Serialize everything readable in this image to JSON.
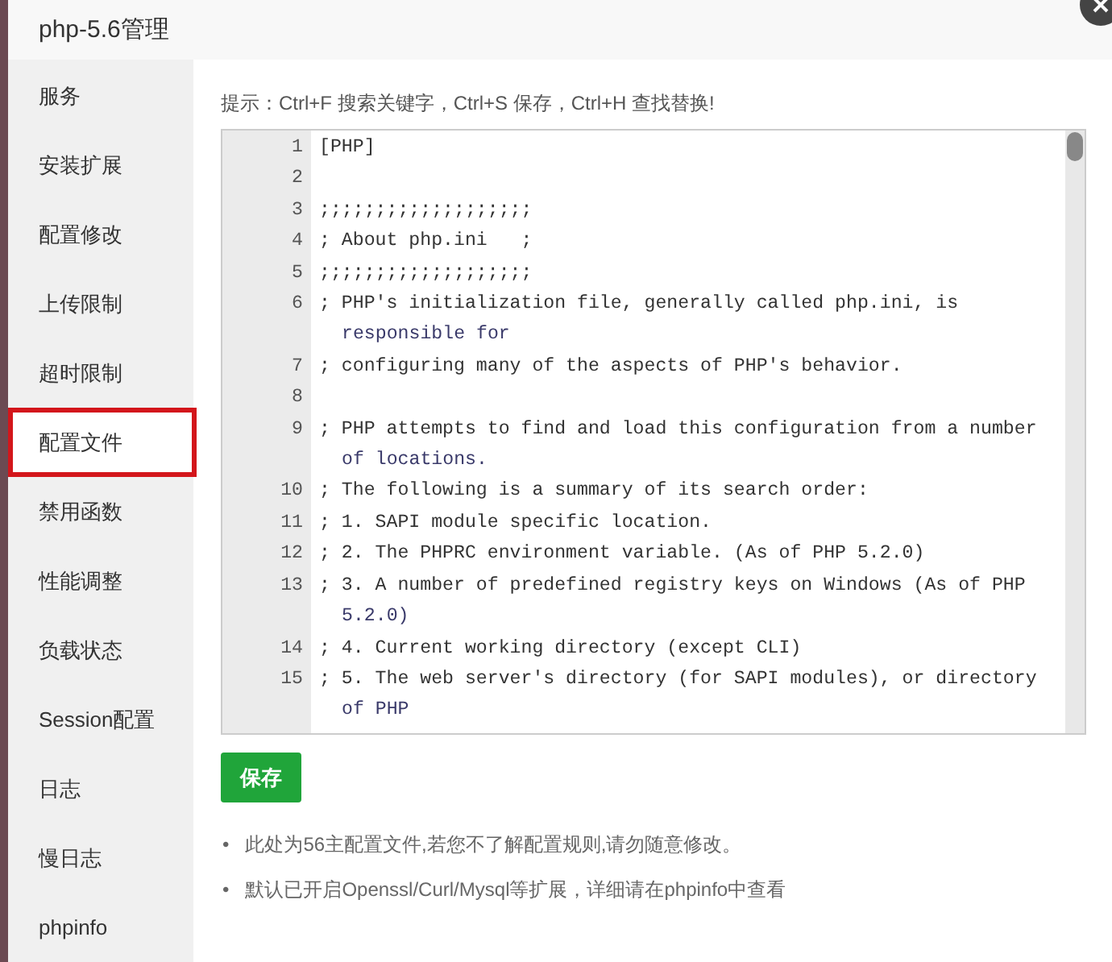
{
  "window": {
    "title": "php-5.6管理"
  },
  "sidebar": {
    "items": [
      {
        "label": "服务",
        "selected": false
      },
      {
        "label": "安装扩展",
        "selected": false
      },
      {
        "label": "配置修改",
        "selected": false
      },
      {
        "label": "上传限制",
        "selected": false
      },
      {
        "label": "超时限制",
        "selected": false
      },
      {
        "label": "配置文件",
        "selected": true
      },
      {
        "label": "禁用函数",
        "selected": false
      },
      {
        "label": "性能调整",
        "selected": false
      },
      {
        "label": "负载状态",
        "selected": false
      },
      {
        "label": "Session配置",
        "selected": false
      },
      {
        "label": "日志",
        "selected": false
      },
      {
        "label": "慢日志",
        "selected": false
      },
      {
        "label": "phpinfo",
        "selected": false
      }
    ]
  },
  "hint": "提示：Ctrl+F 搜索关键字，Ctrl+S 保存，Ctrl+H 查找替换!",
  "editor": {
    "lines": [
      {
        "number": "1",
        "text": [
          "[PHP]"
        ]
      },
      {
        "number": "2"
      },
      {
        "number": "3",
        "text": [
          ";;;;;;;;;;;;;;;;;;;"
        ]
      },
      {
        "number": "4",
        "text": [
          "; About php.ini   ;"
        ]
      },
      {
        "number": "5",
        "text": [
          ";;;;;;;;;;;;;;;;;;;"
        ]
      },
      {
        "number": "6",
        "text": [
          "; PHP's initialization file, generally called php.ini, is",
          "responsible for"
        ]
      },
      {
        "number": "7",
        "text": [
          "; configuring many of the aspects of PHP's behavior."
        ]
      },
      {
        "number": "8"
      },
      {
        "number": "9",
        "text": [
          "; PHP attempts to find and load this configuration from a number",
          "of locations."
        ]
      },
      {
        "number": "10",
        "text": [
          "; The following is a summary of its search order:"
        ]
      },
      {
        "number": "11",
        "text": [
          "; 1. SAPI module specific location."
        ]
      },
      {
        "number": "12",
        "text": [
          "; 2. The PHPRC environment variable. (As of PHP 5.2.0)"
        ]
      },
      {
        "number": "13",
        "text": [
          "; 3. A number of predefined registry keys on Windows (As of PHP",
          "5.2.0)"
        ]
      },
      {
        "number": "14",
        "text": [
          "; 4. Current working directory (except CLI)"
        ]
      },
      {
        "number": "15",
        "text": [
          "; 5. The web server's directory (for SAPI modules), or directory",
          "of PHP"
        ]
      }
    ]
  },
  "save_button": "保存",
  "notes": [
    {
      "bullet": "•",
      "text": "此处为56主配置文件,若您不了解配置规则,请勿随意修改。"
    },
    {
      "bullet": "•",
      "text": "默认已开启Openssl/Curl/Mysql等扩展，详细请在phpinfo中查看"
    }
  ]
}
